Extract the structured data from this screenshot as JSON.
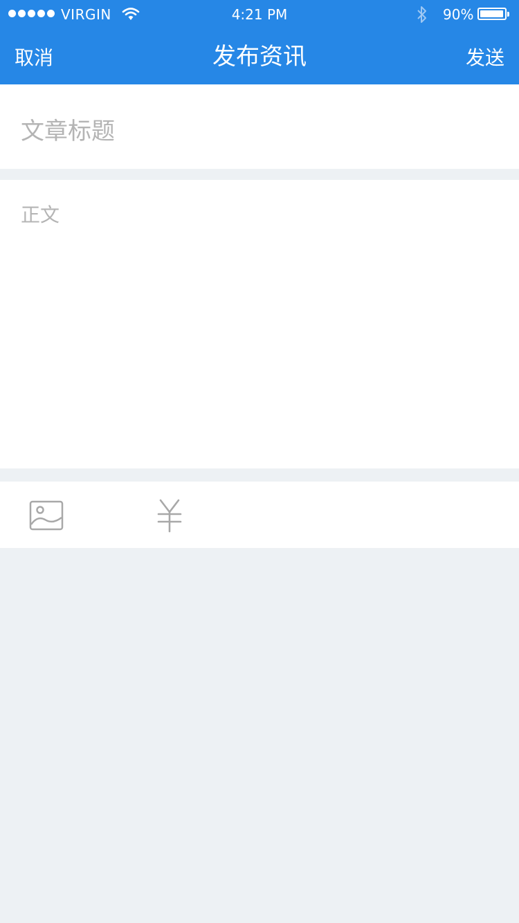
{
  "status_bar": {
    "carrier": "VIRGIN",
    "time": "4:21 PM",
    "battery_percent": "90%"
  },
  "nav": {
    "cancel_label": "取消",
    "title": "发布资讯",
    "send_label": "发送"
  },
  "form": {
    "title_placeholder": "文章标题",
    "body_placeholder": "正文"
  },
  "toolbar": {
    "items": [
      {
        "icon": "image-icon"
      },
      {
        "icon": "yen-icon"
      }
    ]
  },
  "colors": {
    "header_bg": "#2687e6",
    "page_bg": "#edf1f4",
    "placeholder": "#b4b4b4",
    "icon": "#a8a8a8"
  }
}
